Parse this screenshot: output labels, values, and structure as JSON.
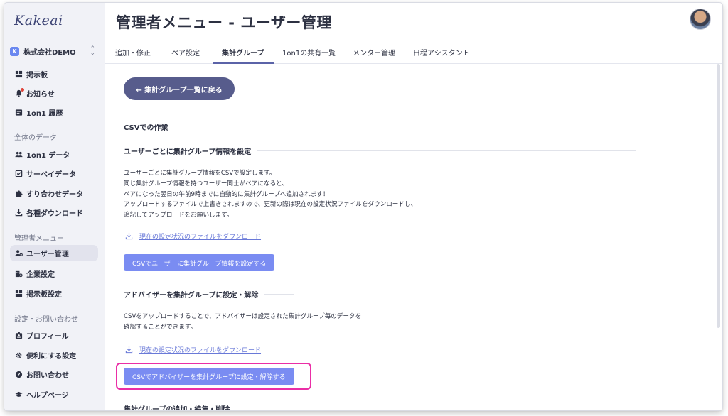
{
  "sidebar": {
    "logo": "Kakeai",
    "company": {
      "badge": "K",
      "name": "株式会社DEMO",
      "switch_icon": "chevrons-up-down-icon"
    },
    "items_top": [
      {
        "label": "掲示板",
        "icon": "board-icon"
      },
      {
        "label": "お知らせ",
        "icon": "bell-icon",
        "has_dot": true
      },
      {
        "label": "1on1 履歴",
        "icon": "history-icon"
      }
    ],
    "section_data": "全体のデータ",
    "items_data": [
      {
        "label": "1on1 データ",
        "icon": "people-icon"
      },
      {
        "label": "サーベイデータ",
        "icon": "survey-icon"
      },
      {
        "label": "すり合わせデータ",
        "icon": "puzzle-icon"
      },
      {
        "label": "各種ダウンロード",
        "icon": "download-icon"
      }
    ],
    "section_admin": "管理者メニュー",
    "items_admin": [
      {
        "label": "ユーザー管理",
        "icon": "user-gear-icon",
        "active": true
      },
      {
        "label": "企業設定",
        "icon": "building-gear-icon"
      },
      {
        "label": "掲示板設定",
        "icon": "board-settings-icon"
      }
    ],
    "section_settings": "設定・お問い合わせ",
    "items_settings": [
      {
        "label": "プロフィール",
        "icon": "profile-icon"
      },
      {
        "label": "便利にする設定",
        "icon": "gear-icon"
      },
      {
        "label": "お問い合わせ",
        "icon": "help-circle-icon"
      },
      {
        "label": "ヘルプページ",
        "icon": "graduation-cap-icon"
      }
    ]
  },
  "header": {
    "title": "管理者メニュー - ユーザー管理",
    "tabs": [
      {
        "label": "追加・修正"
      },
      {
        "label": "ペア設定"
      },
      {
        "label": "集計グループ",
        "active": true
      },
      {
        "label": "1on1の共有一覧"
      },
      {
        "label": "メンター管理"
      },
      {
        "label": "日程アシスタント"
      }
    ]
  },
  "main": {
    "back_button": "← 集計グループ一覧に戻る",
    "csv_section_title": "CSVでの作業",
    "user_section": {
      "heading": "ユーザーごとに集計グループ情報を設定",
      "description": [
        "ユーザーごとに集計グループ情報をCSVで設定します。",
        "同じ集計グループ情報を持つユーザー同士がペアになると、",
        "ペアになった翌日の午前9時までに自動的に集計グループへ追加されます！",
        "アップロードするファイルで上書きされますので、更新の際は現在の設定状況ファイルをダウンロードし、",
        "追記してアップロードをお願いします。"
      ],
      "download_link": "現在の設定状況のファイルをダウンロード",
      "csv_button": "CSVでユーザーに集計グループ情報を設定する"
    },
    "advisor_section": {
      "heading": "アドバイザーを集計グループに設定・解除",
      "description": [
        "CSVをアップロードすることで、アドバイザーは設定された集計グループ毎のデータを",
        "確認することができます。"
      ],
      "download_link": "現在の設定状況のファイルをダウンロード",
      "csv_button": "CSVでアドバイザーを集計グループに設定・解除する"
    },
    "group_edit_section": {
      "heading": "集計グループの追加・編集・削除"
    }
  },
  "colors": {
    "primary_button": "#7a8cf2",
    "back_button": "#575c8c",
    "highlight": "#ea2ea6",
    "link": "#6979d8"
  }
}
